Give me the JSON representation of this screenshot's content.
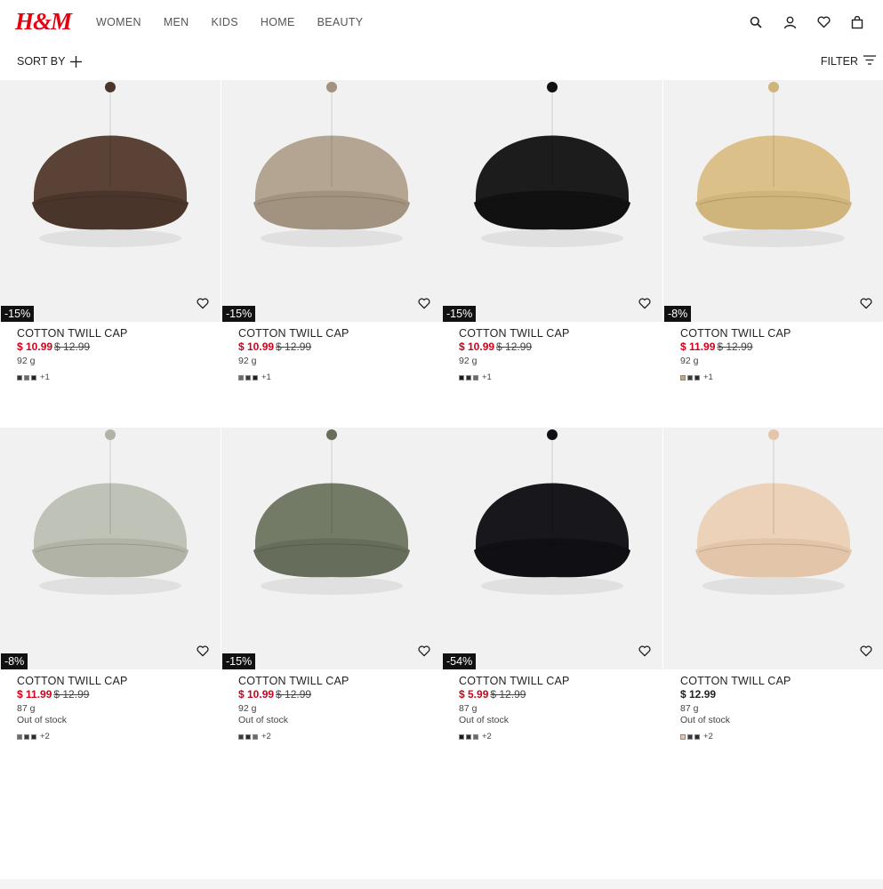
{
  "brand": {
    "logo": "H&M",
    "color": "#e50010"
  },
  "nav": [
    "WOMEN",
    "MEN",
    "KIDS",
    "HOME",
    "BEAUTY"
  ],
  "header_icons": [
    "search-icon",
    "account-icon",
    "favorites-icon",
    "bag-icon"
  ],
  "toolbar": {
    "sort_label": "SORT BY",
    "filter_label": "FILTER"
  },
  "products": [
    {
      "badge": "-15%",
      "name": "COTTON TWILL CAP",
      "price": "$ 10.99",
      "was": "$ 12.99",
      "weight": "92 g",
      "stock": "",
      "swatches": [
        "#3b2f2a",
        "#6b6b6b",
        "#222222"
      ],
      "more": "+1",
      "cap_color": "#5a4236",
      "brim_color": "#4a352b"
    },
    {
      "badge": "-15%",
      "name": "COTTON TWILL CAP",
      "price": "$ 10.99",
      "was": "$ 12.99",
      "weight": "92 g",
      "stock": "",
      "swatches": [
        "#6b6b6b",
        "#3b3b3b",
        "#1f1f1f"
      ],
      "more": "+1",
      "cap_color": "#b4a592",
      "brim_color": "#a29380"
    },
    {
      "badge": "-15%",
      "name": "COTTON TWILL CAP",
      "price": "$ 10.99",
      "was": "$ 12.99",
      "weight": "92 g",
      "stock": "",
      "swatches": [
        "#1a1a1a",
        "#2b2b2b",
        "#6b6b6b"
      ],
      "more": "+1",
      "cap_color": "#1c1c1c",
      "brim_color": "#111111"
    },
    {
      "badge": "-8%",
      "name": "COTTON TWILL CAP",
      "price": "$ 11.99",
      "was": "$ 12.99",
      "weight": "92 g",
      "stock": "",
      "swatches": [
        "#c9a66b",
        "#3b3b3b",
        "#2a2a2a"
      ],
      "more": "+1",
      "cap_color": "#dcc08a",
      "brim_color": "#cfb47c"
    },
    {
      "badge": "-8%",
      "name": "COTTON TWILL CAP",
      "price": "$ 11.99",
      "was": "$ 12.99",
      "weight": "87 g",
      "stock": "Out of stock",
      "swatches": [
        "#6b6b6b",
        "#3b3b3b",
        "#2a2a2a"
      ],
      "more": "+2",
      "cap_color": "#bfc2b6",
      "brim_color": "#b0b3a6"
    },
    {
      "badge": "-15%",
      "name": "COTTON TWILL CAP",
      "price": "$ 10.99",
      "was": "$ 12.99",
      "weight": "92 g",
      "stock": "Out of stock",
      "swatches": [
        "#3b3b3b",
        "#2a2a2a",
        "#6b6b6b"
      ],
      "more": "+2",
      "cap_color": "#737a66",
      "brim_color": "#666d5a"
    },
    {
      "badge": "-54%",
      "name": "COTTON TWILL CAP",
      "price": "$ 5.99",
      "was": "$ 12.99",
      "weight": "87 g",
      "stock": "Out of stock",
      "swatches": [
        "#1a1a1a",
        "#2b2b2b",
        "#6b6b6b"
      ],
      "more": "+2",
      "cap_color": "#18181c",
      "brim_color": "#101014"
    },
    {
      "badge": "",
      "name": "COTTON TWILL CAP",
      "price": "$ 12.99",
      "was": "",
      "weight": "87 g",
      "stock": "Out of stock",
      "swatches": [
        "#e6c6b0",
        "#3b3b3b",
        "#2a2a2a"
      ],
      "more": "+2",
      "cap_color": "#ecd2b8",
      "brim_color": "#e3c6aa"
    }
  ]
}
